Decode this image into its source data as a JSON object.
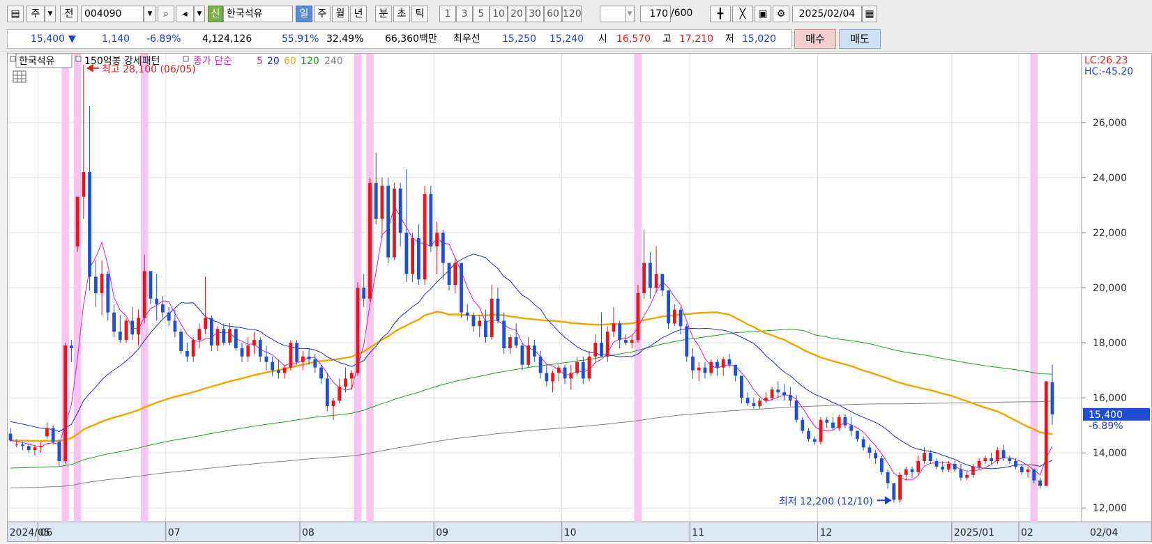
{
  "toolbar": {
    "market": "주",
    "period_type": "전",
    "code": "004090",
    "credit_badge": "신",
    "stock_name": "한국석유",
    "periods": [
      "일",
      "주",
      "월",
      "년",
      "분",
      "초",
      "틱"
    ],
    "active_period": "일",
    "intervals": [
      "1",
      "3",
      "5",
      "10",
      "20",
      "30",
      "60",
      "120"
    ],
    "count": "170",
    "count_max": "/600",
    "date": "2025/02/04"
  },
  "quote": {
    "price": "15,400",
    "change_arrow": "▼",
    "change": "1,140",
    "change_pct": "-6.89%",
    "volume": "4,124,126",
    "vol_ratio": "55.91%",
    "turnover": "32.49%",
    "amount": "66,360백만",
    "best_label": "최우선",
    "best_ask": "15,250",
    "best_bid": "15,240",
    "open_label": "시",
    "open": "16,570",
    "high_label": "고",
    "high": "17,210",
    "low_label": "저",
    "low": "15,020",
    "buy": "매수",
    "sell": "매도"
  },
  "legend": {
    "name": "한국석유",
    "pattern": "150억봉 강세패턴",
    "ma_label": "종가 단순",
    "ma5": "5",
    "ma20": "20",
    "ma60": "60",
    "ma120": "120",
    "ma240": "240",
    "lc": "LC:26.23",
    "hc": "HC:-45.20"
  },
  "colors": {
    "up": "#e8161c",
    "down": "#1f4fd0",
    "ma5": "#e020c0",
    "ma20": "#2030c8",
    "ma60": "#f0a800",
    "ma120": "#20a020",
    "ma240": "#808080",
    "highlight": "#f8c4f0"
  },
  "chart_data": {
    "type": "candlestick",
    "y_range": [
      11500,
      28500
    ],
    "y_ticks": [
      "12,000",
      "14,000",
      "16,000",
      "18,000",
      "20,000",
      "22,000",
      "24,000",
      "26,000"
    ],
    "x_labels": [
      "2024/05",
      "06",
      "07",
      "08",
      "09",
      "10",
      "11",
      "12",
      "2025/01",
      "02",
      "02/04"
    ],
    "last_price_label": "15,400",
    "last_change_label": "-6.89%",
    "annotation_high": "최고 28,100 (06/05)",
    "annotation_low": "최저 12,200 (12/10)",
    "candles": [
      [
        14700,
        14900,
        14400,
        14450
      ],
      [
        14300,
        14500,
        14200,
        14300
      ],
      [
        14300,
        14400,
        14100,
        14250
      ],
      [
        14250,
        14350,
        14000,
        14100
      ],
      [
        14100,
        14300,
        13900,
        14200
      ],
      [
        14200,
        14400,
        14000,
        14250
      ],
      [
        14600,
        15100,
        14500,
        14900
      ],
      [
        14900,
        15000,
        14300,
        14400
      ],
      [
        14400,
        14500,
        13500,
        13700
      ],
      [
        13700,
        18000,
        13600,
        17900
      ],
      [
        17900,
        18100,
        17300,
        17800
      ],
      [
        21500,
        23300,
        21300,
        23300
      ],
      [
        23300,
        28100,
        22500,
        24200
      ],
      [
        24200,
        26600,
        19900,
        20400
      ],
      [
        20400,
        21000,
        19300,
        19800
      ],
      [
        19800,
        21000,
        19000,
        20500
      ],
      [
        20500,
        20600,
        18800,
        19100
      ],
      [
        19100,
        19400,
        18200,
        18400
      ],
      [
        18400,
        19000,
        18000,
        18100
      ],
      [
        18100,
        18900,
        18000,
        18800
      ],
      [
        18800,
        19300,
        18100,
        18300
      ],
      [
        18300,
        19200,
        17900,
        18900
      ],
      [
        18900,
        21200,
        18700,
        20600
      ],
      [
        20600,
        20600,
        19400,
        19600
      ],
      [
        19600,
        20500,
        18800,
        19400
      ],
      [
        19400,
        19700,
        18900,
        19100
      ],
      [
        19100,
        19300,
        18600,
        18800
      ],
      [
        18800,
        19200,
        18200,
        18400
      ],
      [
        18400,
        18500,
        17600,
        17700
      ],
      [
        17700,
        18000,
        17300,
        17500
      ],
      [
        17500,
        18200,
        17300,
        18100
      ],
      [
        18100,
        18700,
        17800,
        18500
      ],
      [
        18500,
        20400,
        18300,
        18900
      ],
      [
        18900,
        19000,
        17700,
        17900
      ],
      [
        17900,
        18600,
        17700,
        18500
      ],
      [
        18500,
        18700,
        17900,
        18000
      ],
      [
        18000,
        18700,
        17900,
        18500
      ],
      [
        18500,
        18600,
        17700,
        17800
      ],
      [
        17800,
        18000,
        17300,
        17500
      ],
      [
        17500,
        18200,
        17300,
        17900
      ],
      [
        17900,
        18400,
        17600,
        18100
      ],
      [
        18100,
        18200,
        17300,
        17500
      ],
      [
        17500,
        17900,
        17000,
        17300
      ],
      [
        17300,
        17500,
        16800,
        17000
      ],
      [
        17000,
        17400,
        16700,
        16900
      ],
      [
        16900,
        17200,
        16700,
        17100
      ],
      [
        17100,
        18100,
        17000,
        18000
      ],
      [
        18000,
        18100,
        17200,
        17300
      ],
      [
        17300,
        17700,
        17000,
        17500
      ],
      [
        17500,
        17800,
        17200,
        17400
      ],
      [
        17400,
        17600,
        16900,
        17100
      ],
      [
        17100,
        17200,
        16500,
        16700
      ],
      [
        16700,
        16900,
        15500,
        15700
      ],
      [
        15700,
        16000,
        15200,
        15900
      ],
      [
        15900,
        16700,
        15800,
        16400
      ],
      [
        16400,
        17100,
        16200,
        16700
      ],
      [
        16700,
        17000,
        16300,
        16900
      ],
      [
        16900,
        20200,
        16800,
        20000
      ],
      [
        20000,
        20500,
        19300,
        19600
      ],
      [
        19600,
        24000,
        19500,
        23800
      ],
      [
        23800,
        24900,
        22300,
        22500
      ],
      [
        22500,
        24000,
        21800,
        23700
      ],
      [
        23700,
        24000,
        20900,
        21100
      ],
      [
        21100,
        23800,
        21000,
        23600
      ],
      [
        23600,
        23800,
        21500,
        22000
      ],
      [
        22000,
        24300,
        20200,
        20500
      ],
      [
        20500,
        22000,
        20200,
        21800
      ],
      [
        21800,
        22300,
        20100,
        20300
      ],
      [
        20300,
        23700,
        20100,
        23400
      ],
      [
        23400,
        23700,
        21300,
        21500
      ],
      [
        21500,
        22400,
        20500,
        22000
      ],
      [
        22000,
        22100,
        20300,
        20900
      ],
      [
        20900,
        20900,
        19900,
        20100
      ],
      [
        20100,
        21100,
        19800,
        20900
      ],
      [
        20900,
        20900,
        18900,
        19100
      ],
      [
        19100,
        19400,
        18800,
        19000
      ],
      [
        19000,
        19100,
        18400,
        18600
      ],
      [
        18600,
        19000,
        18200,
        18800
      ],
      [
        18800,
        19200,
        18000,
        18200
      ],
      [
        18200,
        20100,
        18100,
        19600
      ],
      [
        19600,
        20000,
        18700,
        18800
      ],
      [
        18800,
        19100,
        17600,
        17800
      ],
      [
        17800,
        18300,
        17600,
        18200
      ],
      [
        18200,
        18700,
        17800,
        17900
      ],
      [
        17900,
        18000,
        17000,
        17200
      ],
      [
        17200,
        18200,
        17100,
        17900
      ],
      [
        17900,
        18100,
        17300,
        17500
      ],
      [
        17500,
        17700,
        16700,
        16900
      ],
      [
        16900,
        17200,
        16400,
        16600
      ],
      [
        16600,
        17000,
        16200,
        16900
      ],
      [
        16900,
        17200,
        16600,
        17100
      ],
      [
        17100,
        17200,
        16500,
        16700
      ],
      [
        16700,
        17200,
        16300,
        16900
      ],
      [
        16900,
        17500,
        16800,
        17300
      ],
      [
        17300,
        17500,
        16500,
        16700
      ],
      [
        16700,
        17700,
        16600,
        17500
      ],
      [
        17500,
        18300,
        17300,
        18000
      ],
      [
        18000,
        19100,
        17500,
        17500
      ],
      [
        17500,
        18600,
        17300,
        18400
      ],
      [
        18400,
        19300,
        18200,
        18700
      ],
      [
        18700,
        18800,
        17800,
        18100
      ],
      [
        18100,
        18300,
        17900,
        18000
      ],
      [
        18000,
        18300,
        17800,
        18100
      ],
      [
        18100,
        20100,
        18000,
        19800
      ],
      [
        19800,
        22100,
        19600,
        20900
      ],
      [
        20900,
        21300,
        19600,
        20000
      ],
      [
        20000,
        21500,
        19800,
        20500
      ],
      [
        20500,
        20500,
        19700,
        19900
      ],
      [
        19900,
        19900,
        18500,
        18700
      ],
      [
        18700,
        19400,
        18600,
        19200
      ],
      [
        19200,
        19300,
        18300,
        18600
      ],
      [
        18600,
        18700,
        17300,
        17500
      ],
      [
        17500,
        17800,
        16700,
        17000
      ],
      [
        17000,
        17300,
        16600,
        17100
      ],
      [
        17100,
        17300,
        16700,
        16900
      ],
      [
        16900,
        17400,
        16800,
        17300
      ],
      [
        17300,
        17400,
        16800,
        17100
      ],
      [
        17100,
        17500,
        16800,
        17400
      ],
      [
        17400,
        17600,
        17100,
        17200
      ],
      [
        17200,
        17200,
        16600,
        16800
      ],
      [
        16800,
        16800,
        15800,
        16000
      ],
      [
        16000,
        16200,
        15700,
        15800
      ],
      [
        15800,
        16000,
        15600,
        15700
      ],
      [
        15700,
        16000,
        15600,
        15900
      ],
      [
        15900,
        16200,
        15800,
        16000
      ],
      [
        16000,
        16400,
        15900,
        16300
      ],
      [
        16300,
        16600,
        16000,
        16200
      ],
      [
        16200,
        16500,
        15900,
        16100
      ],
      [
        16100,
        16400,
        15700,
        15900
      ],
      [
        15900,
        16100,
        15100,
        15200
      ],
      [
        15200,
        15300,
        14700,
        14800
      ],
      [
        14800,
        14900,
        14400,
        14500
      ],
      [
        14500,
        14600,
        14300,
        14400
      ],
      [
        14400,
        15300,
        14300,
        15200
      ],
      [
        15200,
        15300,
        14900,
        15100
      ],
      [
        15100,
        15300,
        14800,
        14900
      ],
      [
        14900,
        15400,
        14800,
        15300
      ],
      [
        15300,
        15400,
        14900,
        15000
      ],
      [
        15000,
        15300,
        14600,
        14800
      ],
      [
        14800,
        14800,
        14400,
        14500
      ],
      [
        14500,
        14600,
        14100,
        14200
      ],
      [
        14200,
        14300,
        13800,
        14000
      ],
      [
        14000,
        14100,
        13600,
        13800
      ],
      [
        13800,
        13900,
        13200,
        13300
      ],
      [
        13300,
        13400,
        12700,
        12900
      ],
      [
        12900,
        12900,
        12200,
        12300
      ],
      [
        12300,
        13300,
        12200,
        13200
      ],
      [
        13200,
        13500,
        13000,
        13400
      ],
      [
        13400,
        13500,
        13100,
        13300
      ],
      [
        13300,
        13900,
        13200,
        13700
      ],
      [
        13700,
        14200,
        13600,
        14000
      ],
      [
        14000,
        14100,
        13600,
        13700
      ],
      [
        13700,
        13800,
        13400,
        13500
      ],
      [
        13500,
        13700,
        13300,
        13400
      ],
      [
        13400,
        13700,
        13300,
        13600
      ],
      [
        13600,
        13700,
        13300,
        13400
      ],
      [
        13400,
        13600,
        13000,
        13100
      ],
      [
        13100,
        13300,
        13000,
        13200
      ],
      [
        13200,
        13600,
        13100,
        13500
      ],
      [
        13500,
        13800,
        13400,
        13700
      ],
      [
        13700,
        13900,
        13600,
        13800
      ],
      [
        13800,
        14000,
        13600,
        13700
      ],
      [
        13700,
        14200,
        13600,
        14100
      ],
      [
        14100,
        14300,
        13700,
        13800
      ],
      [
        13800,
        13900,
        13600,
        13700
      ],
      [
        13700,
        13800,
        13400,
        13500
      ],
      [
        13500,
        13600,
        13200,
        13300
      ],
      [
        13300,
        13500,
        13100,
        13400
      ],
      [
        13400,
        13400,
        12900,
        13000
      ],
      [
        13000,
        13100,
        12700,
        12800
      ],
      [
        12800,
        16600,
        12800,
        16600
      ],
      [
        16570,
        17210,
        15020,
        15400
      ]
    ],
    "highlight_days": [
      9,
      11,
      22,
      57,
      59,
      103,
      168
    ]
  }
}
